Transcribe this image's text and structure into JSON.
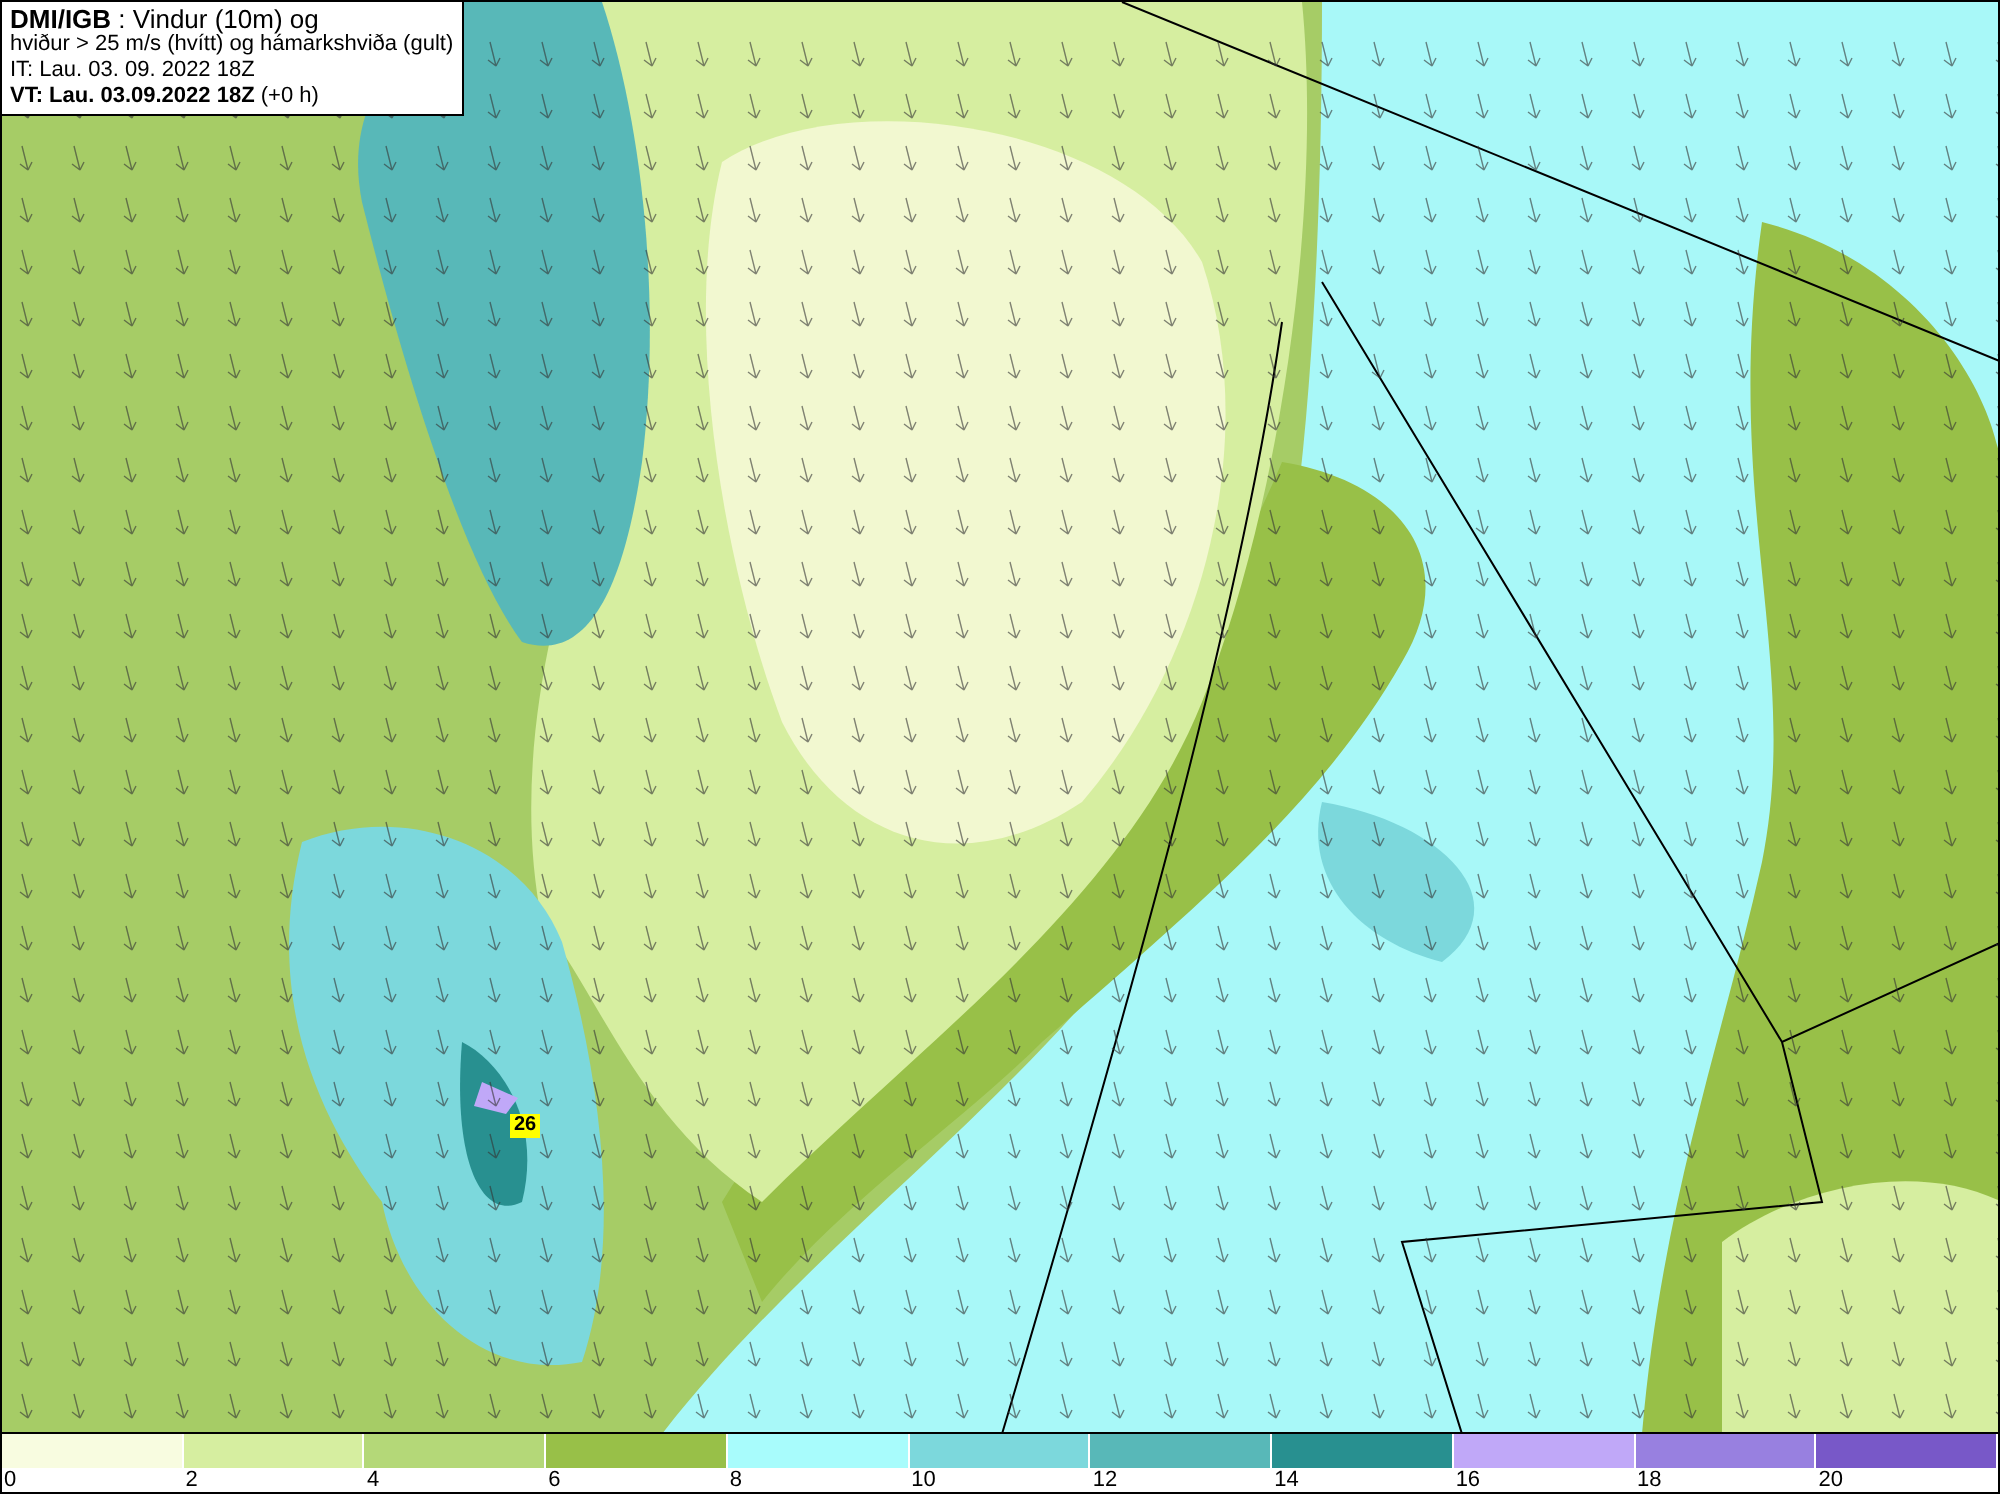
{
  "title_box": {
    "lines": [
      "**DMI/IGB** : Vindur (10m) og",
      "hviður > 25 m/s (hvítt) og hámarkshviða (gult)",
      "IT: Lau. 03. 09. 2022 18Z",
      "**VT: Lau. 03.09.2022 18Z** (+0 h)"
    ]
  },
  "map": {
    "max_gust_badge": "26"
  },
  "legend": [
    {
      "label": "0",
      "color": "#f8fce0"
    },
    {
      "label": "2",
      "color": "#d6eea0"
    },
    {
      "label": "4",
      "color": "#b4d878"
    },
    {
      "label": "6",
      "color": "#98c048"
    },
    {
      "label": "8",
      "color": "#a8fcfc"
    },
    {
      "label": "10",
      "color": "#7cd8dc"
    },
    {
      "label": "12",
      "color": "#58b8b8"
    },
    {
      "label": "14",
      "color": "#289090"
    },
    {
      "label": "16",
      "color": "#c0a8f8"
    },
    {
      "label": "18",
      "color": "#9880e0"
    },
    {
      "label": "20",
      "color": "#7858c8"
    }
  ]
}
